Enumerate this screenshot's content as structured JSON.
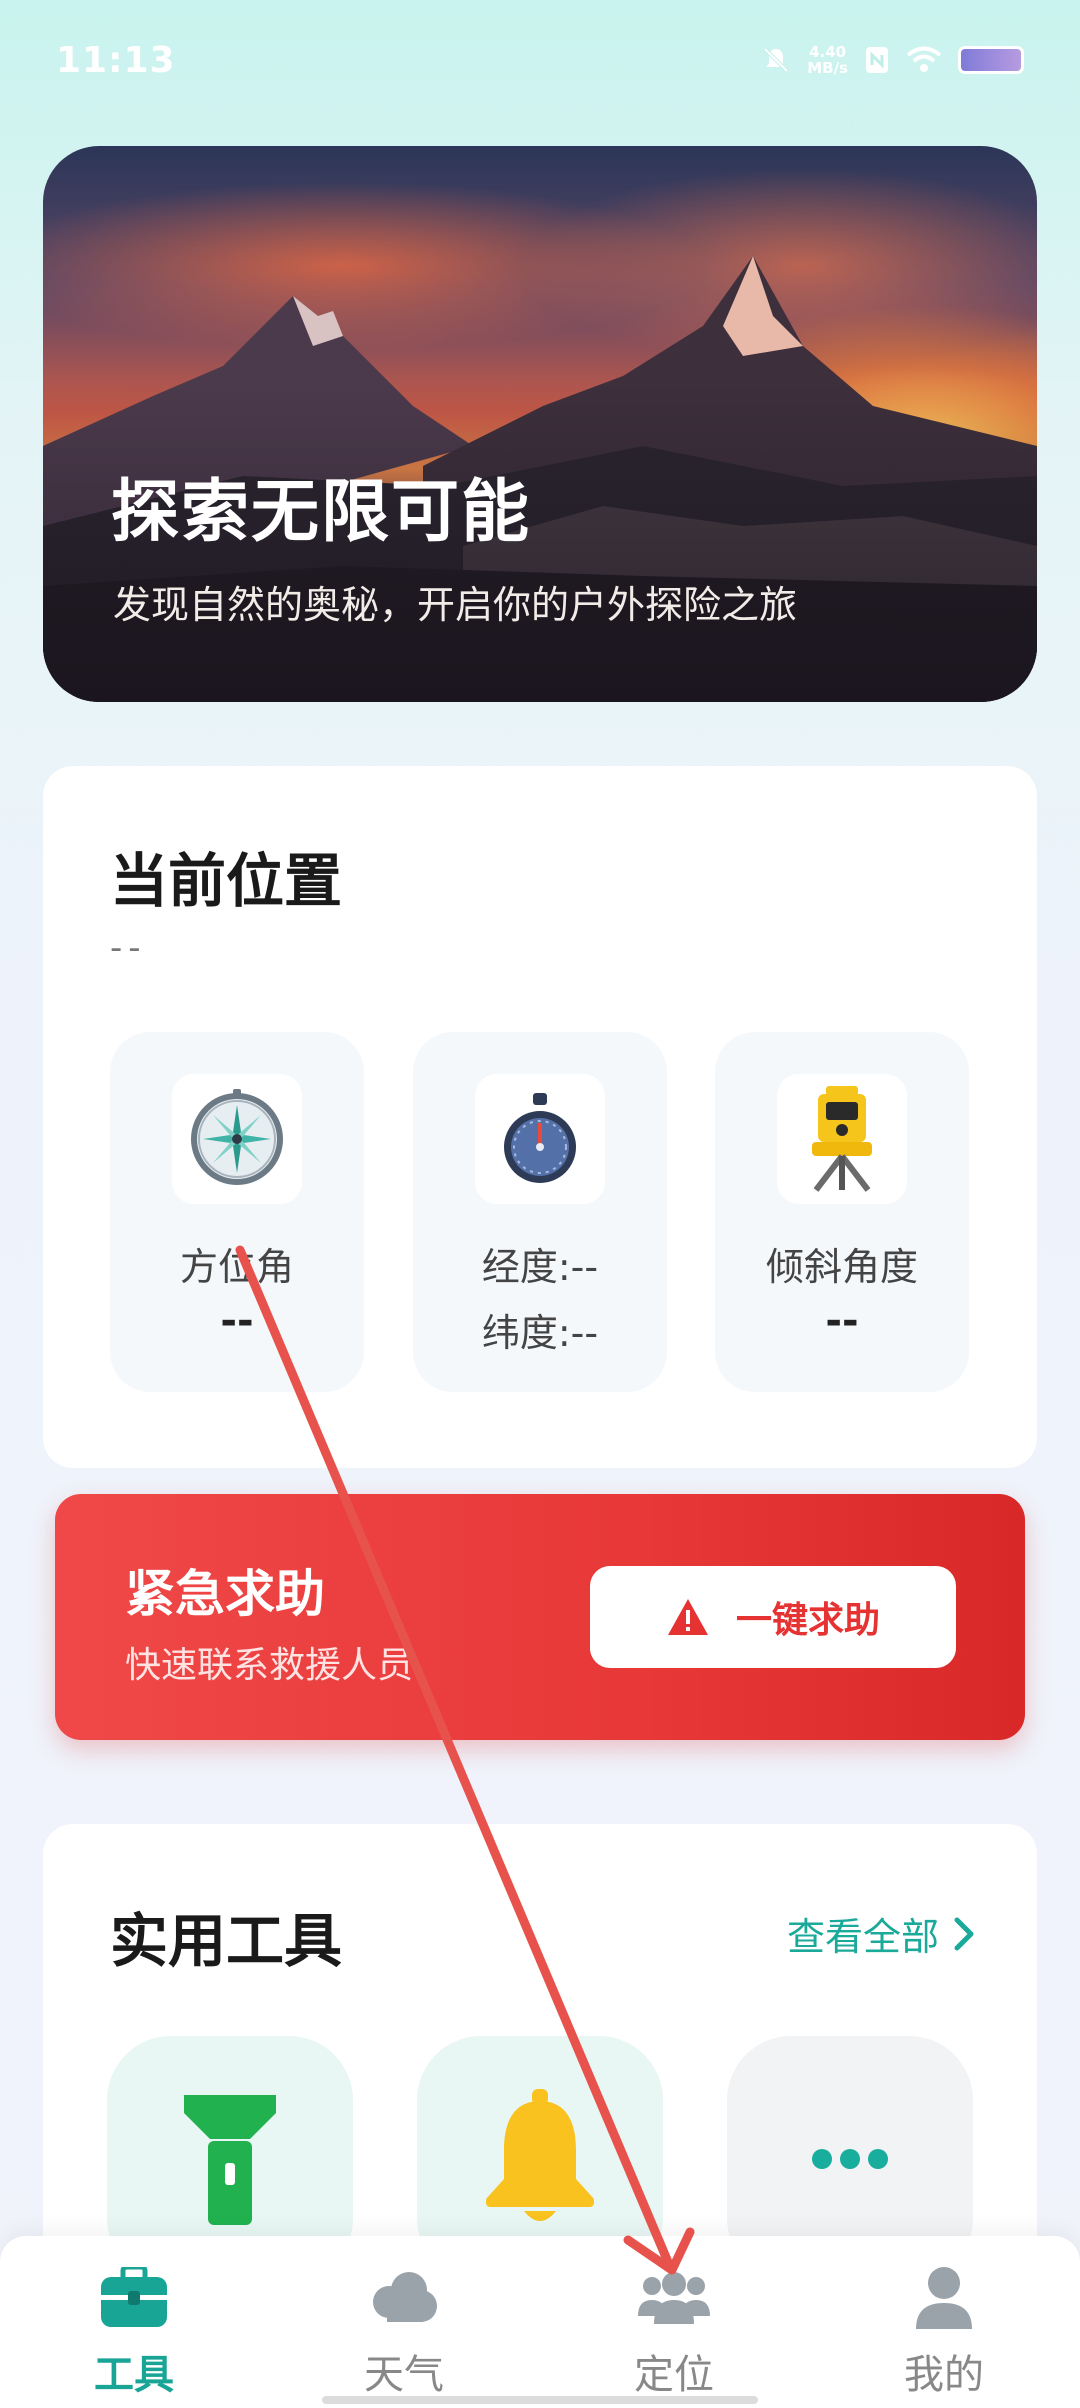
{
  "status_bar": {
    "time": "11:13",
    "speed_value": "4.40",
    "speed_unit": "MB/s",
    "icons": [
      "bell-muted-icon",
      "nfc-icon",
      "wifi-icon",
      "battery-icon"
    ]
  },
  "hero": {
    "title": "探索无限可能",
    "subtitle": "发现自然的奥秘，开启你的户外探险之旅"
  },
  "location": {
    "title": "当前位置",
    "address": "--",
    "metrics": [
      {
        "icon": "compass-icon",
        "label": "方位角",
        "value": "--"
      },
      {
        "icon": "stopwatch-icon",
        "label": "经度:--",
        "value": "纬度:--"
      },
      {
        "icon": "theodolite-icon",
        "label": "倾斜角度",
        "value": "--"
      }
    ]
  },
  "emergency": {
    "title": "紧急求助",
    "subtitle": "快速联系救援人员",
    "button_label": "一键求助",
    "button_icon": "warning-icon",
    "color": "#e83838"
  },
  "tools": {
    "title": "实用工具",
    "view_all": "查看全部",
    "items": [
      {
        "icon": "flashlight-icon",
        "color": "#21b24f"
      },
      {
        "icon": "bell-icon",
        "color": "#f9c21e"
      },
      {
        "icon": "more-icon",
        "color": "#19ad9d"
      }
    ]
  },
  "nav": {
    "items": [
      {
        "label": "工具",
        "icon": "toolbox-icon",
        "active": true
      },
      {
        "label": "天气",
        "icon": "cloud-icon",
        "active": false
      },
      {
        "label": "定位",
        "icon": "people-icon",
        "active": false
      },
      {
        "label": "我的",
        "icon": "person-icon",
        "active": false
      }
    ],
    "active_color": "#18a596",
    "inactive_color": "#888888"
  }
}
